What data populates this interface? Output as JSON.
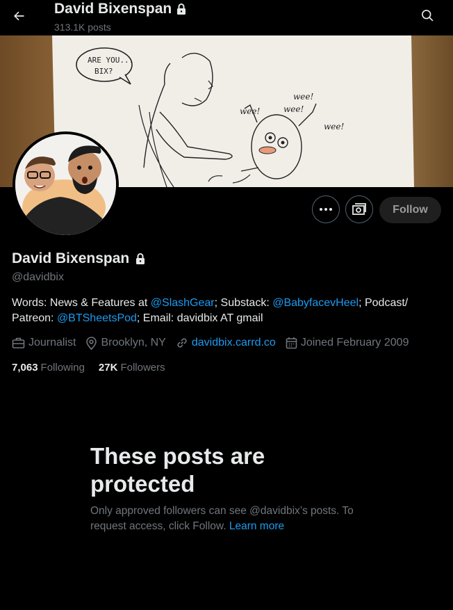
{
  "header": {
    "title": "David Bixenspan",
    "post_count": "313.1K posts"
  },
  "banner": {
    "speech_bubble": "ARE YOU... BIX?",
    "cheer_1": "wee!",
    "cheer_2": "wee!",
    "cheer_3": "wee!",
    "cheer_4": "wee!"
  },
  "actions": {
    "follow_label": "Follow"
  },
  "profile": {
    "name": "David Bixenspan",
    "handle": "@davidbix",
    "bio": {
      "part1": "Words: News & Features at ",
      "link1": "@SlashGear",
      "part2": "; Substack: ",
      "link2": "@BabyfacevHeel",
      "part3": "; Podcast/ Patreon: ",
      "link3": "@BTSheetsPod",
      "part4": "; Email: davidbix AT gmail"
    },
    "meta": {
      "category": "Journalist",
      "location": "Brooklyn, NY",
      "website": "davidbix.carrd.co",
      "joined": "Joined February 2009"
    },
    "stats": {
      "following_count": "7,063",
      "following_label": "Following",
      "followers_count": "27K",
      "followers_label": "Followers"
    }
  },
  "protected": {
    "title": "These posts are protected",
    "text": "Only approved followers can see @davidbix’s posts. To request access, click Follow. ",
    "link": "Learn more"
  },
  "colors": {
    "background": "#000000",
    "text_primary": "#e7e9ea",
    "text_secondary": "#71767b",
    "link": "#1d9bf0",
    "border": "#536471"
  }
}
